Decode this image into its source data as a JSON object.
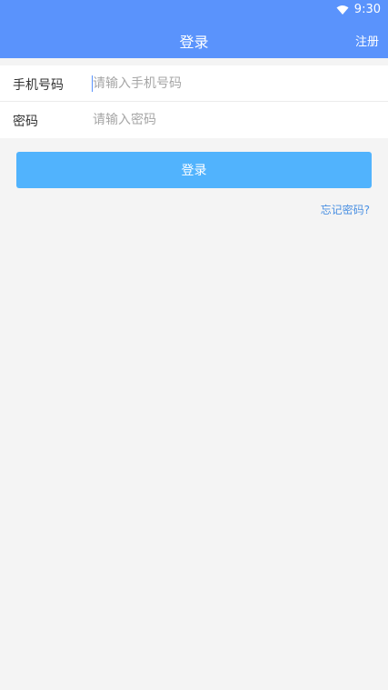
{
  "status_bar": {
    "time": "9:30",
    "wifi_icon": "wifi-icon"
  },
  "app_bar": {
    "title": "登录",
    "register_label": "注册"
  },
  "form": {
    "phone": {
      "label": "手机号码",
      "placeholder": "请输入手机号码",
      "value": ""
    },
    "password": {
      "label": "密码",
      "placeholder": "请输入密码",
      "value": ""
    }
  },
  "login_button_label": "登录",
  "forgot_password_label": "忘记密码?",
  "colors": {
    "primary": "#5a93fc",
    "button": "#51b3fd",
    "link": "#4a90e2",
    "background": "#f4f4f4"
  }
}
